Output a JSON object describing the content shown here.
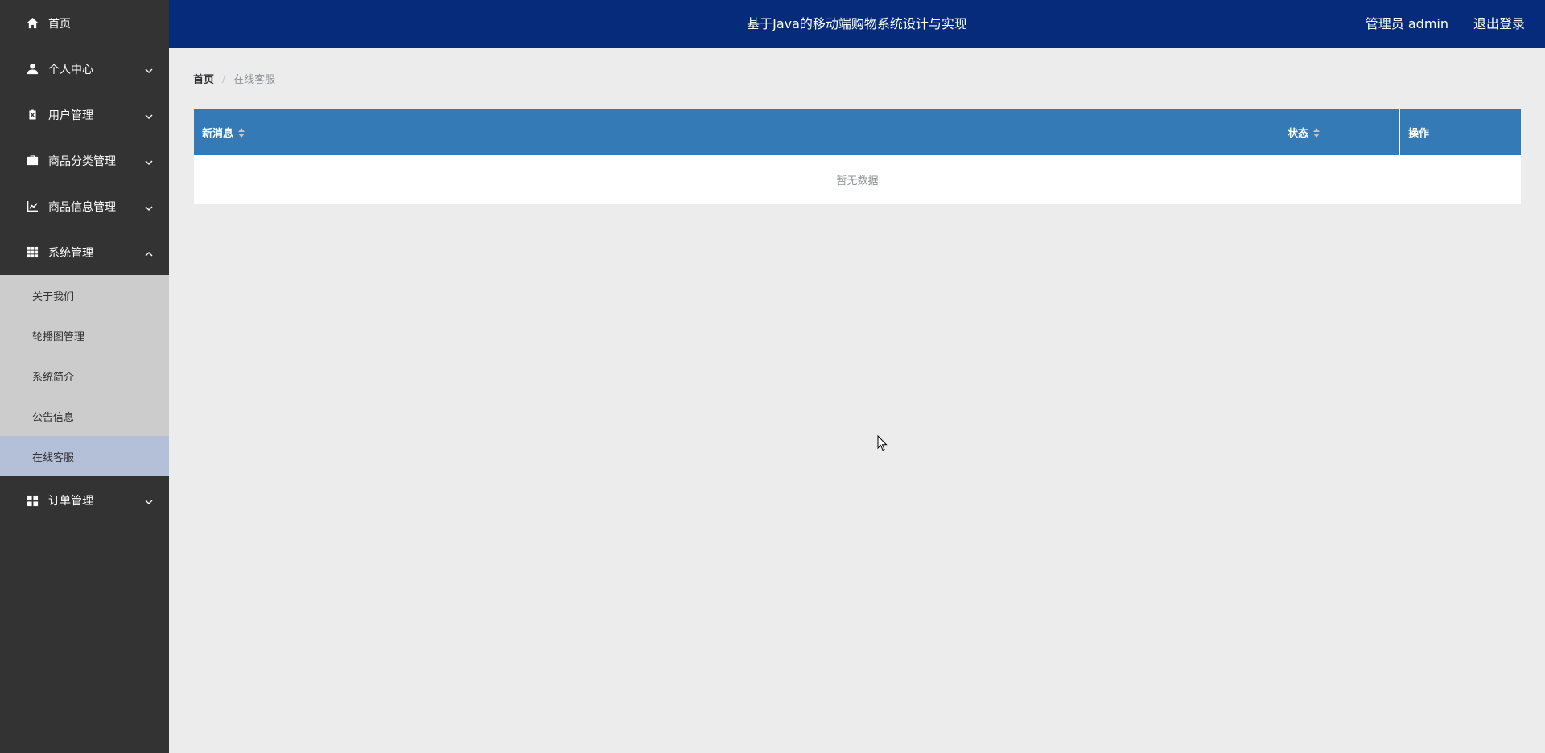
{
  "header": {
    "title": "基于Java的移动端购物系统设计与实现",
    "user": "管理员 admin",
    "logout": "退出登录"
  },
  "sidebar": {
    "items": [
      {
        "label": "首页",
        "icon": "home-icon"
      },
      {
        "label": "个人中心",
        "icon": "user-icon",
        "expandable": true
      },
      {
        "label": "用户管理",
        "icon": "clipboard-icon",
        "expandable": true
      },
      {
        "label": "商品分类管理",
        "icon": "briefcase-icon",
        "expandable": true
      },
      {
        "label": "商品信息管理",
        "icon": "chart-icon",
        "expandable": true
      },
      {
        "label": "系统管理",
        "icon": "grid-icon",
        "expandable": true,
        "expanded": true
      },
      {
        "label": "订单管理",
        "icon": "apps-icon",
        "expandable": true
      }
    ],
    "submenu": [
      {
        "label": "关于我们"
      },
      {
        "label": "轮播图管理"
      },
      {
        "label": "系统简介"
      },
      {
        "label": "公告信息"
      },
      {
        "label": "在线客服",
        "active": true
      }
    ]
  },
  "breadcrumb": {
    "home": "首页",
    "separator": "/",
    "current": "在线客服"
  },
  "table": {
    "columns": [
      {
        "label": "新消息",
        "sortable": true
      },
      {
        "label": "状态",
        "sortable": true
      },
      {
        "label": "操作",
        "sortable": false
      }
    ],
    "empty_text": "暂无数据"
  },
  "colors": {
    "sidebar_bg": "#333333",
    "header_bg": "#052b7a",
    "table_header_bg": "#337ab7",
    "submenu_bg": "#cccccc",
    "active_item_bg": "#b4bfd8",
    "content_bg": "#ececec"
  }
}
